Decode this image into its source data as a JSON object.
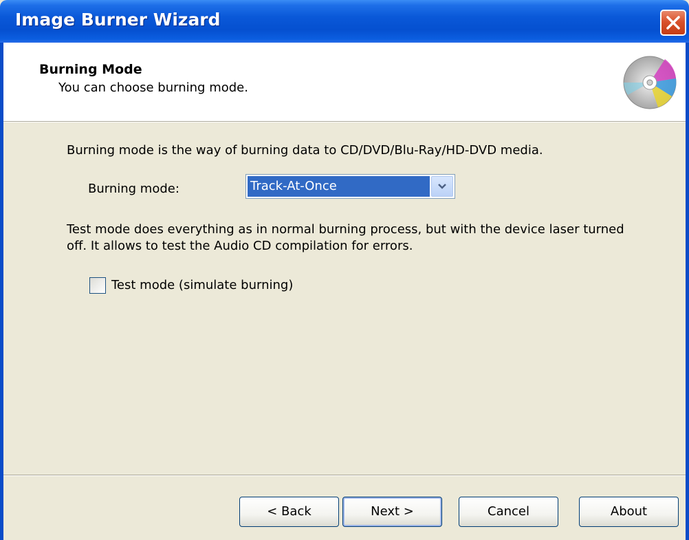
{
  "window": {
    "title": "Image Burner Wizard"
  },
  "header": {
    "title": "Burning Mode",
    "subtitle": "You can choose burning mode.",
    "icon": "cd-disc-icon"
  },
  "content": {
    "description": "Burning mode is the way of burning data to CD/DVD/Blu-Ray/HD-DVD media.",
    "mode_label": "Burning mode:",
    "mode_selected": "Track-At-Once",
    "test_description": "Test mode does everything as in normal burning process, but with the device laser turned off. It allows to test the Audio CD compilation for errors.",
    "test_mode_label": "Test mode (simulate burning)",
    "test_mode_checked": false
  },
  "buttons": {
    "back": "< Back",
    "next": "Next >",
    "cancel": "Cancel",
    "about": "About"
  },
  "colors": {
    "title_bar": "#0550d0",
    "selection": "#316ac5",
    "background": "#ece9d8"
  }
}
